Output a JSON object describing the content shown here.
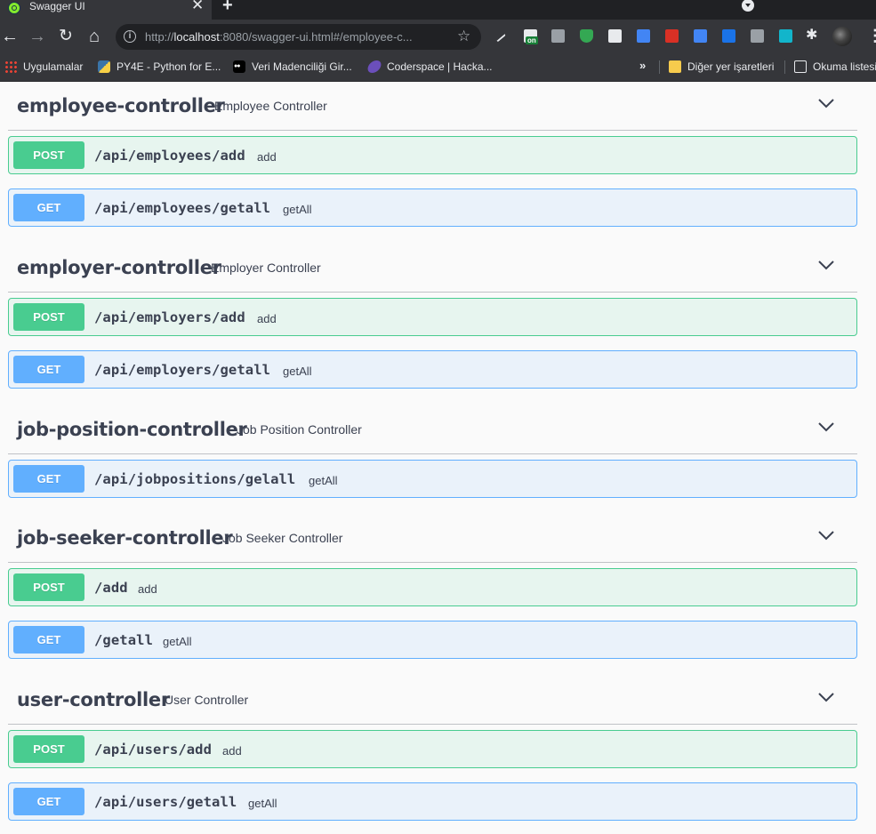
{
  "browser": {
    "tab_title": "Swagger UI",
    "tab_close": "✕",
    "new_tab": "+",
    "url_scheme_path_before": "http://",
    "url_host": "localhost",
    "url_rest": ":8080/swagger-ui.html#/employee-c...",
    "extension_badge": "on",
    "bookmarks": [
      {
        "label": "Uygulamalar",
        "icon": "apps-grid-icon"
      },
      {
        "label": "PY4E - Python for E...",
        "icon": "python-icon"
      },
      {
        "label": "Veri Madenciliği Gir...",
        "icon": "medium-icon"
      },
      {
        "label": "Coderspace | Hacka...",
        "icon": "coderspace-icon"
      },
      {
        "label": "Diğer yer işaretleri",
        "icon": "folder-icon"
      },
      {
        "label": "Okuma listesi",
        "icon": "reading-list-icon"
      }
    ],
    "bookmarks_overflow": "»"
  },
  "colors": {
    "post": "#49cc90",
    "get": "#61affe",
    "text": "#3b4151"
  },
  "sections": [
    {
      "name": "employee-controller",
      "description": "Employee Controller",
      "operations": [
        {
          "method": "POST",
          "path": "/api/employees/add",
          "summary": "add"
        },
        {
          "method": "GET",
          "path": "/api/employees/getall",
          "summary": "getAll"
        }
      ]
    },
    {
      "name": "employer-controller",
      "description": "Employer Controller",
      "operations": [
        {
          "method": "POST",
          "path": "/api/employers/add",
          "summary": "add"
        },
        {
          "method": "GET",
          "path": "/api/employers/getall",
          "summary": "getAll"
        }
      ]
    },
    {
      "name": "job-position-controller",
      "description": "Job Position Controller",
      "operations": [
        {
          "method": "GET",
          "path": "/api/jobpositions/gelall",
          "summary": "getAll"
        }
      ]
    },
    {
      "name": "job-seeker-controller",
      "description": "Job Seeker Controller",
      "operations": [
        {
          "method": "POST",
          "path": "/add",
          "summary": "add"
        },
        {
          "method": "GET",
          "path": "/getall",
          "summary": "getAll"
        }
      ]
    },
    {
      "name": "user-controller",
      "description": "User Controller",
      "operations": [
        {
          "method": "POST",
          "path": "/api/users/add",
          "summary": "add"
        },
        {
          "method": "GET",
          "path": "/api/users/getall",
          "summary": "getAll"
        }
      ]
    }
  ]
}
